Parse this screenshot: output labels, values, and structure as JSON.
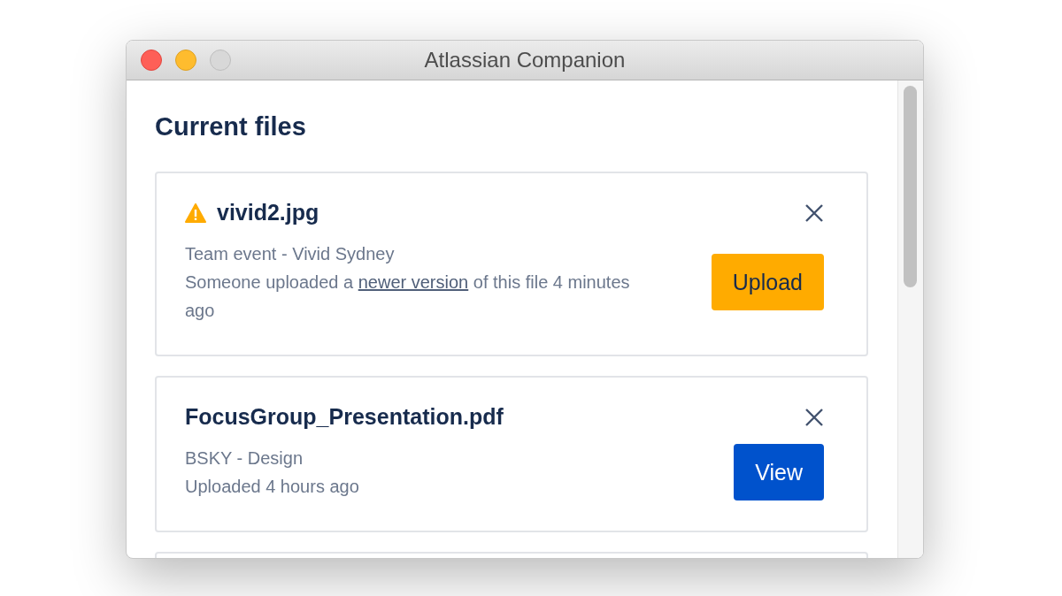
{
  "window": {
    "title": "Atlassian Companion"
  },
  "heading": "Current files",
  "files": [
    {
      "name": "vivid2.jpg",
      "warning": true,
      "details": [
        {
          "kind": "text",
          "text": "Team event - Vivid Sydney"
        },
        {
          "kind": "link_text",
          "before": "Someone uploaded a ",
          "link": "newer version",
          "after": " of this file 4 minutes ago"
        }
      ],
      "action": {
        "kind": "upload",
        "label": "Upload"
      }
    },
    {
      "name": "FocusGroup_Presentation.pdf",
      "warning": false,
      "details": [
        {
          "kind": "text",
          "text": "BSKY - Design"
        },
        {
          "kind": "text",
          "text": "Uploaded 4 hours ago"
        }
      ],
      "action": {
        "kind": "view",
        "label": "View"
      }
    }
  ]
}
